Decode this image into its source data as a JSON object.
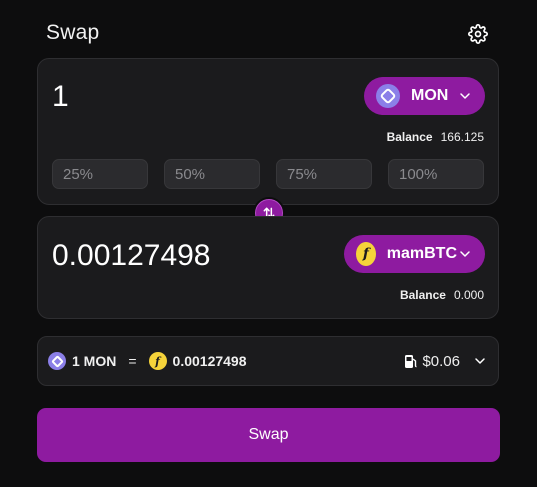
{
  "header": {
    "title": "Swap"
  },
  "from": {
    "amount": "1",
    "token": "MON",
    "balance_label": "Balance",
    "balance_value": "166.125",
    "percentages": [
      "25%",
      "50%",
      "75%",
      "100%"
    ]
  },
  "to": {
    "amount": "0.00127498",
    "token": "mamBTC",
    "balance_label": "Balance",
    "balance_value": "0.000"
  },
  "rate": {
    "from_text": "1 MON",
    "equals": "=",
    "to_text": "0.00127498",
    "gas": "$0.06"
  },
  "action": {
    "label": "Swap"
  },
  "colors": {
    "accent": "#8e1ba0",
    "panel": "#1b1b1d",
    "background": "#0d0d0e"
  }
}
